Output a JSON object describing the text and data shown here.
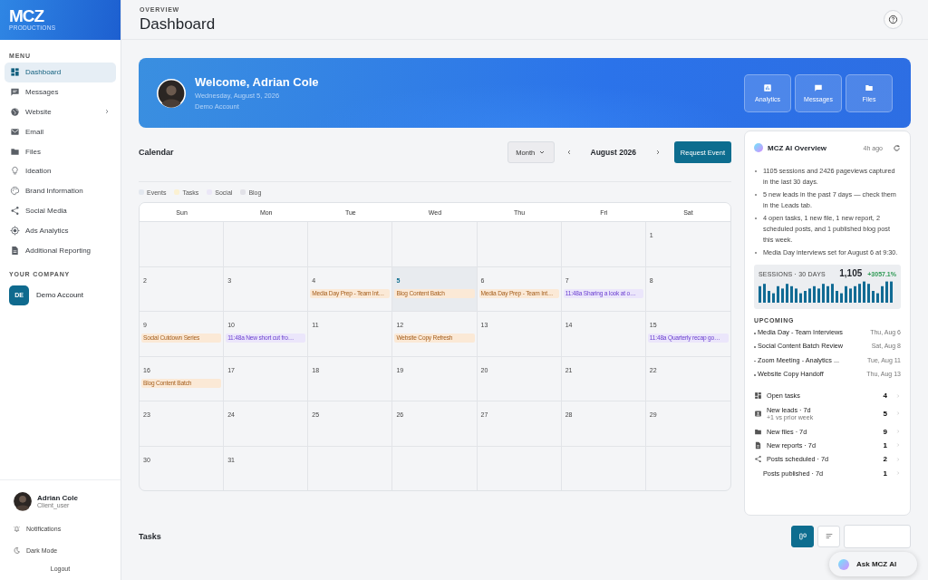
{
  "sidebar": {
    "logo": "MCZ",
    "logo_sub": "PRODUCTIONS",
    "menu_label": "MENU",
    "items": [
      {
        "label": "Dashboard",
        "selected": true,
        "expandable": false
      },
      {
        "label": "Messages",
        "selected": false,
        "expandable": false
      },
      {
        "label": "Website",
        "selected": false,
        "expandable": true
      },
      {
        "label": "Email",
        "selected": false,
        "expandable": false
      },
      {
        "label": "Files",
        "selected": false,
        "expandable": false
      },
      {
        "label": "Ideation",
        "selected": false,
        "expandable": false
      },
      {
        "label": "Brand Information",
        "selected": false,
        "expandable": false
      },
      {
        "label": "Social Media",
        "selected": false,
        "expandable": false
      },
      {
        "label": "Ads Analytics",
        "selected": false,
        "expandable": false
      },
      {
        "label": "Additional Reporting",
        "selected": false,
        "expandable": false
      }
    ],
    "company_label": "YOUR COMPANY",
    "company": {
      "initials": "DE",
      "name": "Demo Account"
    },
    "user": {
      "name": "Adrian Cole",
      "role": "Client_user"
    },
    "footer_items": [
      "Notifications",
      "Dark Mode"
    ],
    "logout": "Logout"
  },
  "header": {
    "eyebrow": "OVERVIEW",
    "title": "Dashboard"
  },
  "banner": {
    "title": "Welcome, Adrian Cole",
    "date": "Wednesday, August 5, 2026",
    "account": "Demo Account",
    "buttons": [
      "Analytics",
      "Messages",
      "Files"
    ]
  },
  "calendar": {
    "title": "Calendar",
    "view": "Month",
    "period": "August 2026",
    "request_button": "Request Event",
    "legend": [
      {
        "label": "Events",
        "color": "#e3e8ef"
      },
      {
        "label": "Tasks",
        "color": "#fbf1d2"
      },
      {
        "label": "Social",
        "color": "#ebe7f7"
      },
      {
        "label": "Blog",
        "color": "#e2e2e8"
      }
    ],
    "weekdays": [
      "Sun",
      "Mon",
      "Tue",
      "Wed",
      "Thu",
      "Fri",
      "Sat"
    ],
    "days": [
      {
        "kind": "blank"
      },
      {
        "kind": "blank"
      },
      {
        "kind": "blank"
      },
      {
        "kind": "blank"
      },
      {
        "kind": "blank"
      },
      {
        "kind": "blank"
      },
      {
        "day": "1",
        "today": false
      },
      {
        "day": "2",
        "today": false
      },
      {
        "day": "3",
        "today": false
      },
      {
        "day": "4",
        "today": false,
        "events": [
          {
            "kind": "task",
            "text": "Media Day Prep - Team Int…"
          }
        ]
      },
      {
        "day": "5",
        "today": true,
        "events": [
          {
            "kind": "task",
            "text": "Blog Content Batch"
          }
        ]
      },
      {
        "day": "6",
        "today": false,
        "events": [
          {
            "kind": "task",
            "text": "Media Day Prep - Team Int…"
          }
        ]
      },
      {
        "day": "7",
        "today": false,
        "events": [
          {
            "kind": "social",
            "text": "11:48a Sharing a look at o…"
          }
        ]
      },
      {
        "day": "8",
        "today": false
      },
      {
        "day": "9",
        "today": false,
        "events": [
          {
            "kind": "task",
            "text": "Social Cutdown Series"
          }
        ]
      },
      {
        "day": "10",
        "today": false,
        "events": [
          {
            "kind": "social",
            "text": "11:48a New short cut fro…"
          }
        ]
      },
      {
        "day": "11",
        "today": false
      },
      {
        "day": "12",
        "today": false,
        "events": [
          {
            "kind": "task",
            "text": "Website Copy Refresh"
          }
        ]
      },
      {
        "day": "13",
        "today": false
      },
      {
        "day": "14",
        "today": false
      },
      {
        "day": "15",
        "today": false,
        "events": [
          {
            "kind": "social",
            "text": "11:48a Quarterly recap go…"
          }
        ]
      },
      {
        "day": "16",
        "today": false,
        "events": [
          {
            "kind": "task",
            "text": "Blog Content Batch"
          }
        ]
      },
      {
        "day": "17",
        "today": false
      },
      {
        "day": "18",
        "today": false
      },
      {
        "day": "19",
        "today": false
      },
      {
        "day": "20",
        "today": false
      },
      {
        "day": "21",
        "today": false
      },
      {
        "day": "22",
        "today": false
      },
      {
        "day": "23",
        "today": false
      },
      {
        "day": "24",
        "today": false
      },
      {
        "day": "25",
        "today": false
      },
      {
        "day": "26",
        "today": false
      },
      {
        "day": "27",
        "today": false
      },
      {
        "day": "28",
        "today": false
      },
      {
        "day": "29",
        "today": false
      },
      {
        "day": "30",
        "today": false
      },
      {
        "day": "31",
        "today": false
      }
    ]
  },
  "overview": {
    "title": "MCZ AI Overview",
    "updated": "4h ago",
    "bullets": [
      "1105 sessions and 2426 pageviews captured in the last 30 days.",
      "5 new leads in the past 7 days — check them in the Leads tab.",
      "4 open tasks, 1 new file, 1 new report, 2 scheduled posts, and 1 published blog post this week.",
      "Media Day interviews set for August 6 at 9:30."
    ],
    "sessions": {
      "label": "SESSIONS · 30 DAYS",
      "value": "1,105",
      "change": "+3057.1%"
    },
    "upcoming_label": "UPCOMING",
    "upcoming": [
      {
        "title": "Media Day - Team Interviews",
        "date": "Thu, Aug 6"
      },
      {
        "title": "Social Content Batch Review",
        "date": "Sat, Aug 8"
      },
      {
        "title": "Zoom Meeting - Analytics ...",
        "date": "Tue, Aug 11"
      },
      {
        "title": "Website Copy Handoff",
        "date": "Thu, Aug 13"
      }
    ],
    "stats": [
      {
        "label": "Open tasks",
        "value": "4"
      },
      {
        "label": "New leads · 7d",
        "sub": "+1 vs prior week",
        "value": "5"
      },
      {
        "label": "New files · 7d",
        "value": "9"
      },
      {
        "label": "New reports · 7d",
        "value": "1"
      },
      {
        "label": "Posts scheduled · 7d",
        "value": "2"
      },
      {
        "label": "Posts published · 7d",
        "value": "1"
      }
    ]
  },
  "tasks": {
    "title": "Tasks",
    "views": [
      {
        "selected": true
      },
      {
        "selected": false
      }
    ]
  },
  "assistant_button": "Ask MCZ AI"
}
